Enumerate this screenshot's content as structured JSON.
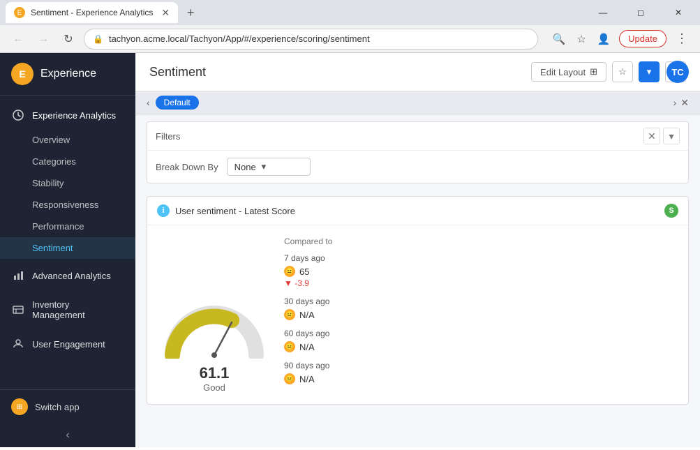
{
  "browser": {
    "tab_title": "Sentiment - Experience Analytics",
    "tab_favicon": "E",
    "url": "tachyon.acme.local/Tachyon/App/#/experience/scoring/sentiment",
    "update_btn": "Update"
  },
  "app": {
    "logo_text": "E",
    "title": "Experience",
    "user_initials": "TC"
  },
  "sidebar": {
    "sections": [
      {
        "id": "experience-analytics",
        "label": "Experience Analytics",
        "icon": "📊",
        "active": true,
        "sub_items": [
          {
            "id": "overview",
            "label": "Overview"
          },
          {
            "id": "categories",
            "label": "Categories"
          },
          {
            "id": "stability",
            "label": "Stability"
          },
          {
            "id": "responsiveness",
            "label": "Responsiveness"
          },
          {
            "id": "performance",
            "label": "Performance"
          },
          {
            "id": "sentiment",
            "label": "Sentiment",
            "active": true
          }
        ]
      },
      {
        "id": "advanced-analytics",
        "label": "Advanced Analytics",
        "icon": "📈",
        "active": false,
        "sub_items": []
      },
      {
        "id": "inventory-management",
        "label": "Inventory Management",
        "icon": "🖥",
        "active": false,
        "sub_items": []
      },
      {
        "id": "user-engagement",
        "label": "User Engagement",
        "icon": "📋",
        "active": false,
        "sub_items": []
      }
    ],
    "footer": {
      "icon": "E",
      "label": "Switch app"
    },
    "collapse_arrow": "‹"
  },
  "main": {
    "title": "Sentiment",
    "edit_layout_btn": "Edit Layout",
    "header_icons": {
      "star": "☆",
      "dropdown": "▾",
      "expand": "⤢"
    }
  },
  "tabs": {
    "arrow_left": "‹",
    "active_tab": "Default",
    "right_arrow": "›",
    "close": "✕"
  },
  "filters": {
    "title": "Filters",
    "close_icon": "✕",
    "menu_icon": "▾",
    "breakdown_label": "Break Down By",
    "breakdown_value": "None",
    "breakdown_arrow": "▾"
  },
  "card": {
    "title": "User sentiment - Latest Score",
    "badge": "S",
    "info_icon": "i",
    "gauge": {
      "value": "61.1",
      "label": "Good"
    },
    "comparison_title": "Compared to",
    "comparisons": [
      {
        "period": "7 days ago",
        "value": "65",
        "delta": "-3.9",
        "has_delta": true
      },
      {
        "period": "30 days ago",
        "value": "N/A",
        "has_delta": false
      },
      {
        "period": "60 days ago",
        "value": "N/A",
        "has_delta": false
      },
      {
        "period": "90 days ago",
        "value": "N/A",
        "has_delta": false
      }
    ]
  }
}
